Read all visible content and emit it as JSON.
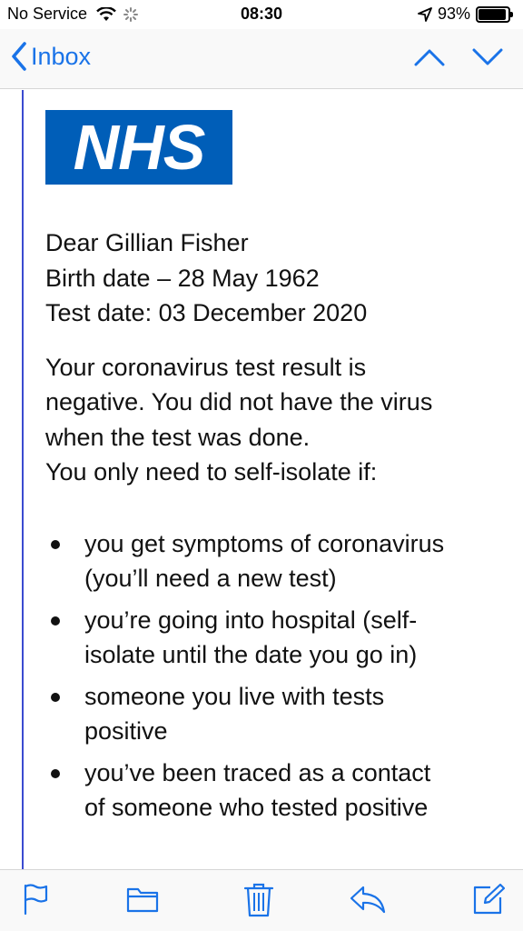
{
  "status_bar": {
    "carrier": "No Service",
    "time": "08:30",
    "battery_percent": "93%",
    "battery_level": 0.93,
    "icons": [
      "wifi-icon",
      "activity-spinner-icon",
      "location-arrow-icon",
      "battery-icon"
    ]
  },
  "nav": {
    "back_label": "Inbox",
    "icons": [
      "chevron-left-icon",
      "chevron-up-icon",
      "chevron-down-icon"
    ]
  },
  "message": {
    "logo_text": "NHS",
    "accent_color": "#005eb8",
    "greeting": {
      "line1": "Dear Gillian Fisher",
      "line2": "Birth date – 28 May 1962",
      "line3": "Test date: 03 December 2020"
    },
    "intro": {
      "line1": "Your coronavirus test result is",
      "line2": "negative. You did not have the virus",
      "line3": "when the test was done.",
      "line4": "You only need to self-isolate if:"
    },
    "bullets": [
      {
        "line1": "you get symptoms of coronavirus",
        "line2": "(you’ll need a new test)"
      },
      {
        "line1": "you’re going into hospital (self-",
        "line2": "isolate until the date you go in)"
      },
      {
        "line1": "someone you live with tests",
        "line2": "positive"
      },
      {
        "line1": "you’ve been traced as a contact",
        "line2": "of someone who tested positive"
      }
    ]
  },
  "toolbar": {
    "icons": [
      "flag-icon",
      "folder-icon",
      "trash-icon",
      "reply-icon",
      "compose-icon"
    ],
    "tint_color": "#1a73e8"
  }
}
